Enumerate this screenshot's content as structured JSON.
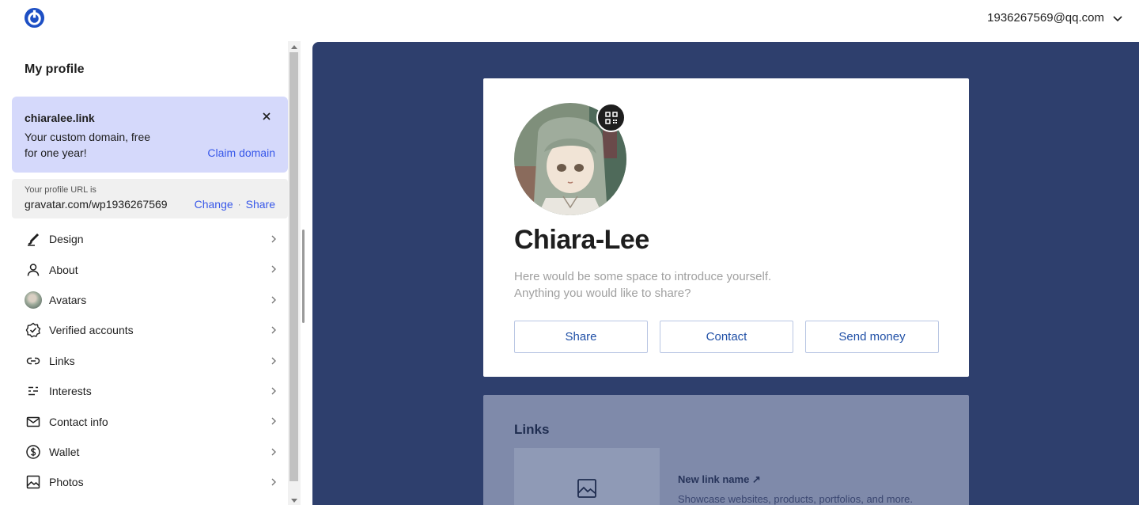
{
  "header": {
    "logo_icon": "gravatar-power-icon",
    "account_email": "1936267569@qq.com",
    "accent": "#1d4fc4"
  },
  "sidebar": {
    "title": "My profile",
    "domain_card": {
      "domain": "chiaralee.link",
      "description": "Your custom domain, free for one year!",
      "claim_label": "Claim domain",
      "background": "#d5d9fb"
    },
    "profile_url": {
      "label": "Your profile URL is",
      "value": "gravatar.com/wp1936267569",
      "change_label": "Change",
      "separator": "·",
      "share_label": "Share"
    },
    "items": [
      {
        "label": "Design",
        "icon": "brush-icon"
      },
      {
        "label": "About",
        "icon": "person-icon"
      },
      {
        "label": "Avatars",
        "icon": "avatar-thumbnail"
      },
      {
        "label": "Verified accounts",
        "icon": "verified-badge-icon"
      },
      {
        "label": "Links",
        "icon": "link-icon"
      },
      {
        "label": "Interests",
        "icon": "interests-icon"
      },
      {
        "label": "Contact info",
        "icon": "envelope-icon"
      },
      {
        "label": "Wallet",
        "icon": "dollar-circle-icon"
      },
      {
        "label": "Photos",
        "icon": "image-icon"
      }
    ]
  },
  "preview": {
    "background": "#2e3f6d",
    "profile": {
      "name": "Chiara-Lee",
      "bio": "Here would be some space to introduce yourself. Anything you would like to share?",
      "buttons": [
        "Share",
        "Contact",
        "Send money"
      ]
    },
    "links": {
      "title": "Links",
      "new_link_name": "New link name ↗",
      "new_link_desc": "Showcase websites, products, portfolios, and more."
    }
  }
}
